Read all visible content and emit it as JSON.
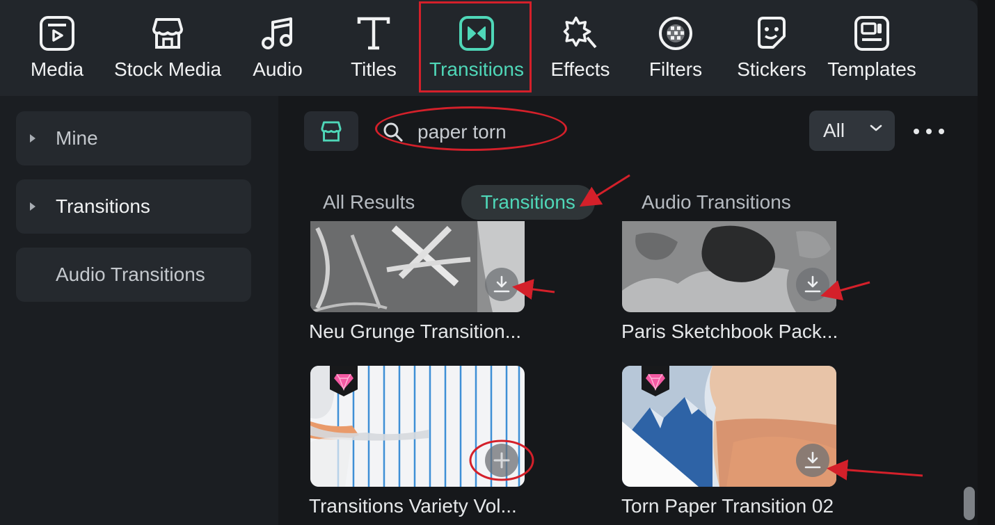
{
  "toolbar": {
    "items": [
      {
        "label": "Media",
        "icon": "media-icon"
      },
      {
        "label": "Stock Media",
        "icon": "stock-media-icon"
      },
      {
        "label": "Audio",
        "icon": "audio-icon"
      },
      {
        "label": "Titles",
        "icon": "titles-icon"
      },
      {
        "label": "Transitions",
        "icon": "transitions-icon",
        "active": true
      },
      {
        "label": "Effects",
        "icon": "effects-icon"
      },
      {
        "label": "Filters",
        "icon": "filters-icon"
      },
      {
        "label": "Stickers",
        "icon": "stickers-icon"
      },
      {
        "label": "Templates",
        "icon": "templates-icon"
      }
    ]
  },
  "sidebar": {
    "items": [
      {
        "label": "Mine",
        "expandable": true
      },
      {
        "label": "Transitions",
        "expandable": true
      },
      {
        "label": "Audio Transitions",
        "expandable": false
      }
    ]
  },
  "search": {
    "value": "paper torn"
  },
  "filter": {
    "selected": "All"
  },
  "tabs": [
    {
      "label": "All Results"
    },
    {
      "label": "Transitions",
      "active": true
    },
    {
      "label": "Audio Transitions"
    }
  ],
  "results": [
    {
      "title": "Neu Grunge Transition...",
      "action": "download"
    },
    {
      "title": "Paris Sketchbook Pack...",
      "action": "download"
    },
    {
      "title": "Transitions Variety Vol...",
      "action": "add",
      "premium": true
    },
    {
      "title": "Torn Paper Transition 02",
      "action": "download",
      "premium": true
    }
  ],
  "colors": {
    "accent": "#4fd7b8",
    "annotation": "#d4202a",
    "background": "#16181b"
  }
}
